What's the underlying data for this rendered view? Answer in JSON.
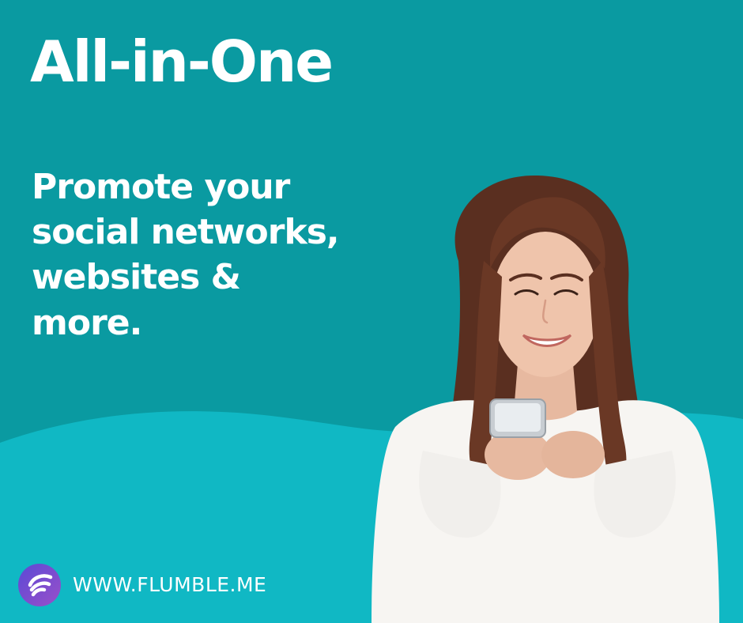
{
  "headline": "All-in-One",
  "subheadline": {
    "lines": [
      "Promote your",
      "social networks,",
      "websites &",
      "more."
    ]
  },
  "footer": {
    "url": "WWW.FLUMBLE.ME",
    "logo_icon": "flumble-logo-icon"
  },
  "colors": {
    "top_teal": "#0a9aa1",
    "bottom_teal": "#10b8c4",
    "text": "#ffffff",
    "logo_circle": "#7b4dc9"
  },
  "image": {
    "subject_icon": "woman-with-phone-photo"
  }
}
